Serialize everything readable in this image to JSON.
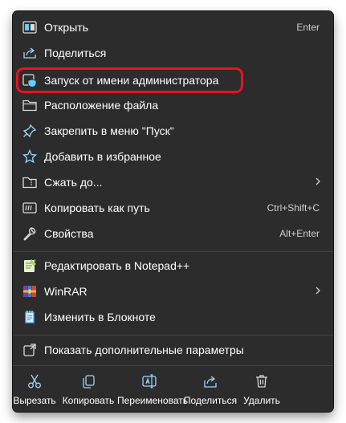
{
  "menu": {
    "items": [
      {
        "label": "Открыть",
        "shortcut": "Enter"
      },
      {
        "label": "Поделиться",
        "shortcut": ""
      },
      {
        "label": "Запуск от имени администратора",
        "shortcut": ""
      },
      {
        "label": "Расположение файла",
        "shortcut": ""
      },
      {
        "label": "Закрепить в меню \"Пуск\"",
        "shortcut": ""
      },
      {
        "label": "Добавить в избранное",
        "shortcut": ""
      },
      {
        "label": "Сжать до...",
        "shortcut": ""
      },
      {
        "label": "Копировать как путь",
        "shortcut": "Ctrl+Shift+C"
      },
      {
        "label": "Свойства",
        "shortcut": "Alt+Enter"
      },
      {
        "label": "Редактировать в Notepad++",
        "shortcut": ""
      },
      {
        "label": "WinRAR",
        "shortcut": ""
      },
      {
        "label": "Изменить в Блокноте",
        "shortcut": ""
      },
      {
        "label": "Показать дополнительные параметры",
        "shortcut": ""
      }
    ],
    "toolbar": [
      {
        "label": "Вырезать",
        "icon": "scissors-icon"
      },
      {
        "label": "Копировать",
        "icon": "copy-icon"
      },
      {
        "label": "Переименовать",
        "icon": "rename-icon"
      },
      {
        "label": "Поделиться",
        "icon": "share-icon"
      },
      {
        "label": "Удалить",
        "icon": "trash-icon"
      }
    ]
  },
  "icons": {
    "open": "app-window-icon",
    "share": "share-icon",
    "run_as_admin": "admin-shield-icon",
    "file_location": "folder-icon",
    "pin_start": "pin-icon",
    "favorite": "star-icon",
    "compress": "zip-folder-icon",
    "copy_path": "copy-path-icon",
    "properties": "wrench-icon",
    "notepadpp": "notepad-plus-plus-icon",
    "winrar": "winrar-icon",
    "notepad": "notepad-icon",
    "more_options": "more-options-icon"
  },
  "colors": {
    "menu_background": "#2c2c2c",
    "text": "#ffffff",
    "accent_icon": "#60cdff",
    "highlight_outline": "#e81221"
  }
}
